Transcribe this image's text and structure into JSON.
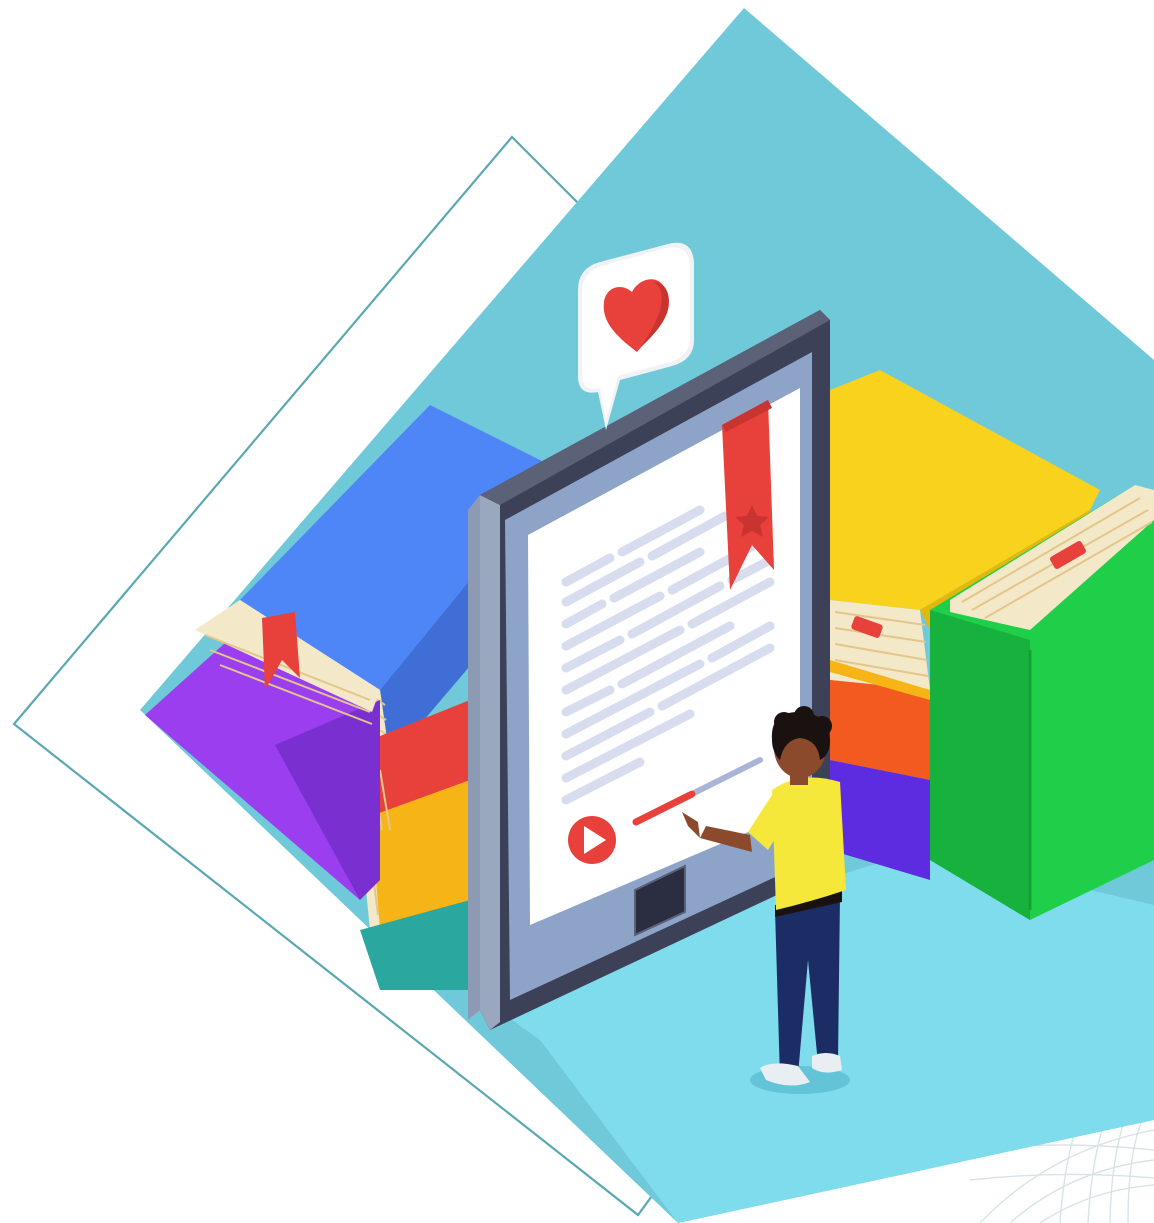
{
  "illustration": {
    "subject": "ebook-reader-with-books",
    "icons": [
      "heart-icon",
      "bookmark-icon",
      "star-icon",
      "play-icon"
    ],
    "colors": {
      "background": "#ffffff",
      "diamond": "#6fc9d9",
      "diamond_floor": "#7fd7e8",
      "outline": "#5aa8b2",
      "tablet_frame": "#3c4158",
      "tablet_bezel": "#8c9bb3",
      "screen": "#ffffff",
      "text_lines": "#d7dcee",
      "accent_red": "#e8413c",
      "book_blue": "#4f86f7",
      "book_purple": "#9a3ef0",
      "book_yellow": "#f8d21c",
      "book_orange": "#f6b416",
      "book_green": "#1fcf4a",
      "book_indigo": "#5e2ce0",
      "pages": "#f3e8c8",
      "shirt": "#f5e83a",
      "trousers": "#1c2d66",
      "skin": "#8b4a2b",
      "hair": "#1a1210"
    },
    "playback_progress": 0.45
  }
}
